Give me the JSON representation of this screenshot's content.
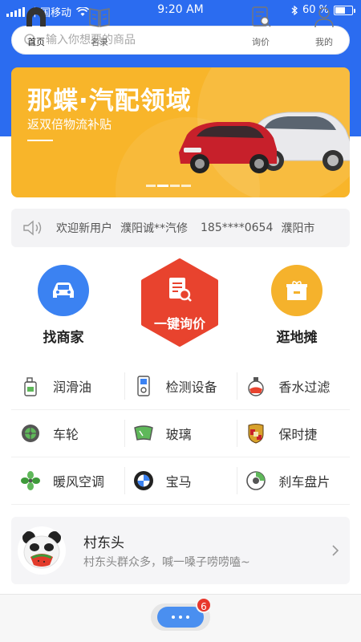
{
  "status_bar": {
    "carrier": "中国移动",
    "time": "9:20 AM",
    "battery_text": "60 %",
    "battery_level": 0.6
  },
  "search": {
    "placeholder": "输入你想要的商品"
  },
  "banner": {
    "title": "那蝶·汽配领域",
    "subtitle": "返双倍物流补贴",
    "slide_count": 4,
    "active_slide": 1
  },
  "notice": {
    "greeting": "欢迎新用户",
    "shop": "濮阳诚**汽修",
    "phone": "185****0654",
    "city": "濮阳市"
  },
  "quick_actions": {
    "find_merchant": "找商家",
    "inquiry": "一键询价",
    "browse_stalls": "逛地摊"
  },
  "categories": [
    [
      "润滑油",
      "检测设备",
      "香水过滤"
    ],
    [
      "车轮",
      "玻璃",
      "保时捷"
    ],
    [
      "暖风空调",
      "宝马",
      "刹车盘片"
    ]
  ],
  "community": {
    "name": "村东头",
    "description": "村东头群众多，喊一嗓子唠唠嗑~"
  },
  "tabs": {
    "home": "首页",
    "directory": "名录",
    "inquiry": "询价",
    "mine": "我的",
    "message_badge": "6"
  },
  "colors": {
    "primary": "#2b6cf0",
    "banner": "#f8b52a",
    "hex": "#e8432e",
    "find_merchant": "#3b82f2",
    "browse_stalls": "#f5b22c",
    "badge": "#e8372c"
  }
}
